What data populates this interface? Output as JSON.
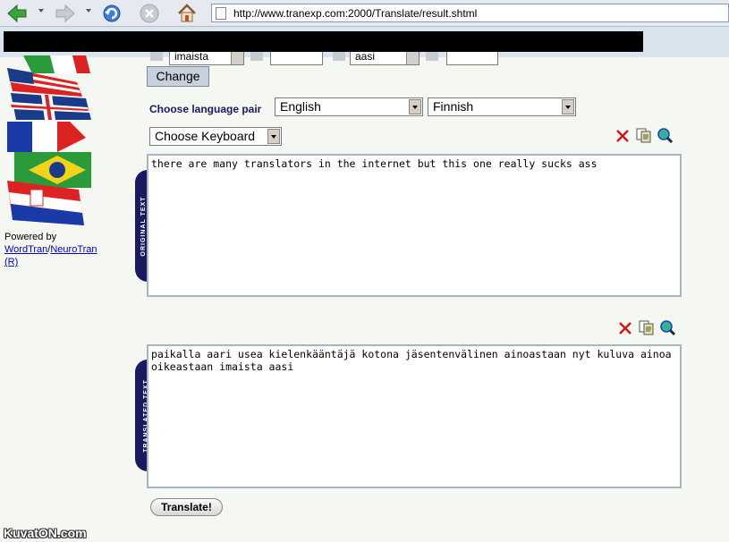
{
  "browser": {
    "url": "http://www.tranexp.com:2000/Translate/result.shtml"
  },
  "top_row": {
    "word_left": "imaista",
    "word_right": "aasi"
  },
  "change_label": "Change",
  "pair_label": "Choose language pair",
  "source_language": "English",
  "target_language": "Finnish",
  "keyboard_label": "Choose Keyboard",
  "original_tab": "ORIGINAL TEXT",
  "translated_tab": "TRANSLATED TEXT",
  "original_text": "there are many translators in the internet but this one really sucks ass",
  "translated_text": "paikalla aari usea kielenkääntäjä kotona jäsentenvälinen ainoastaan nyt kuluva ainoa oikeastaan imaista aasi",
  "translate_button": "Translate!",
  "sidebar": {
    "powered_by": "Powered by",
    "link_wordtran": "WordTran",
    "slash": "/",
    "link_neurotran": "NeuroTran",
    "link_r": "(R)"
  },
  "watermark": "KuvatON.com",
  "icons": [
    "back-icon",
    "forward-icon",
    "refresh-icon",
    "stop-icon",
    "home-icon",
    "clear-icon",
    "copy-icon",
    "search-icon"
  ]
}
